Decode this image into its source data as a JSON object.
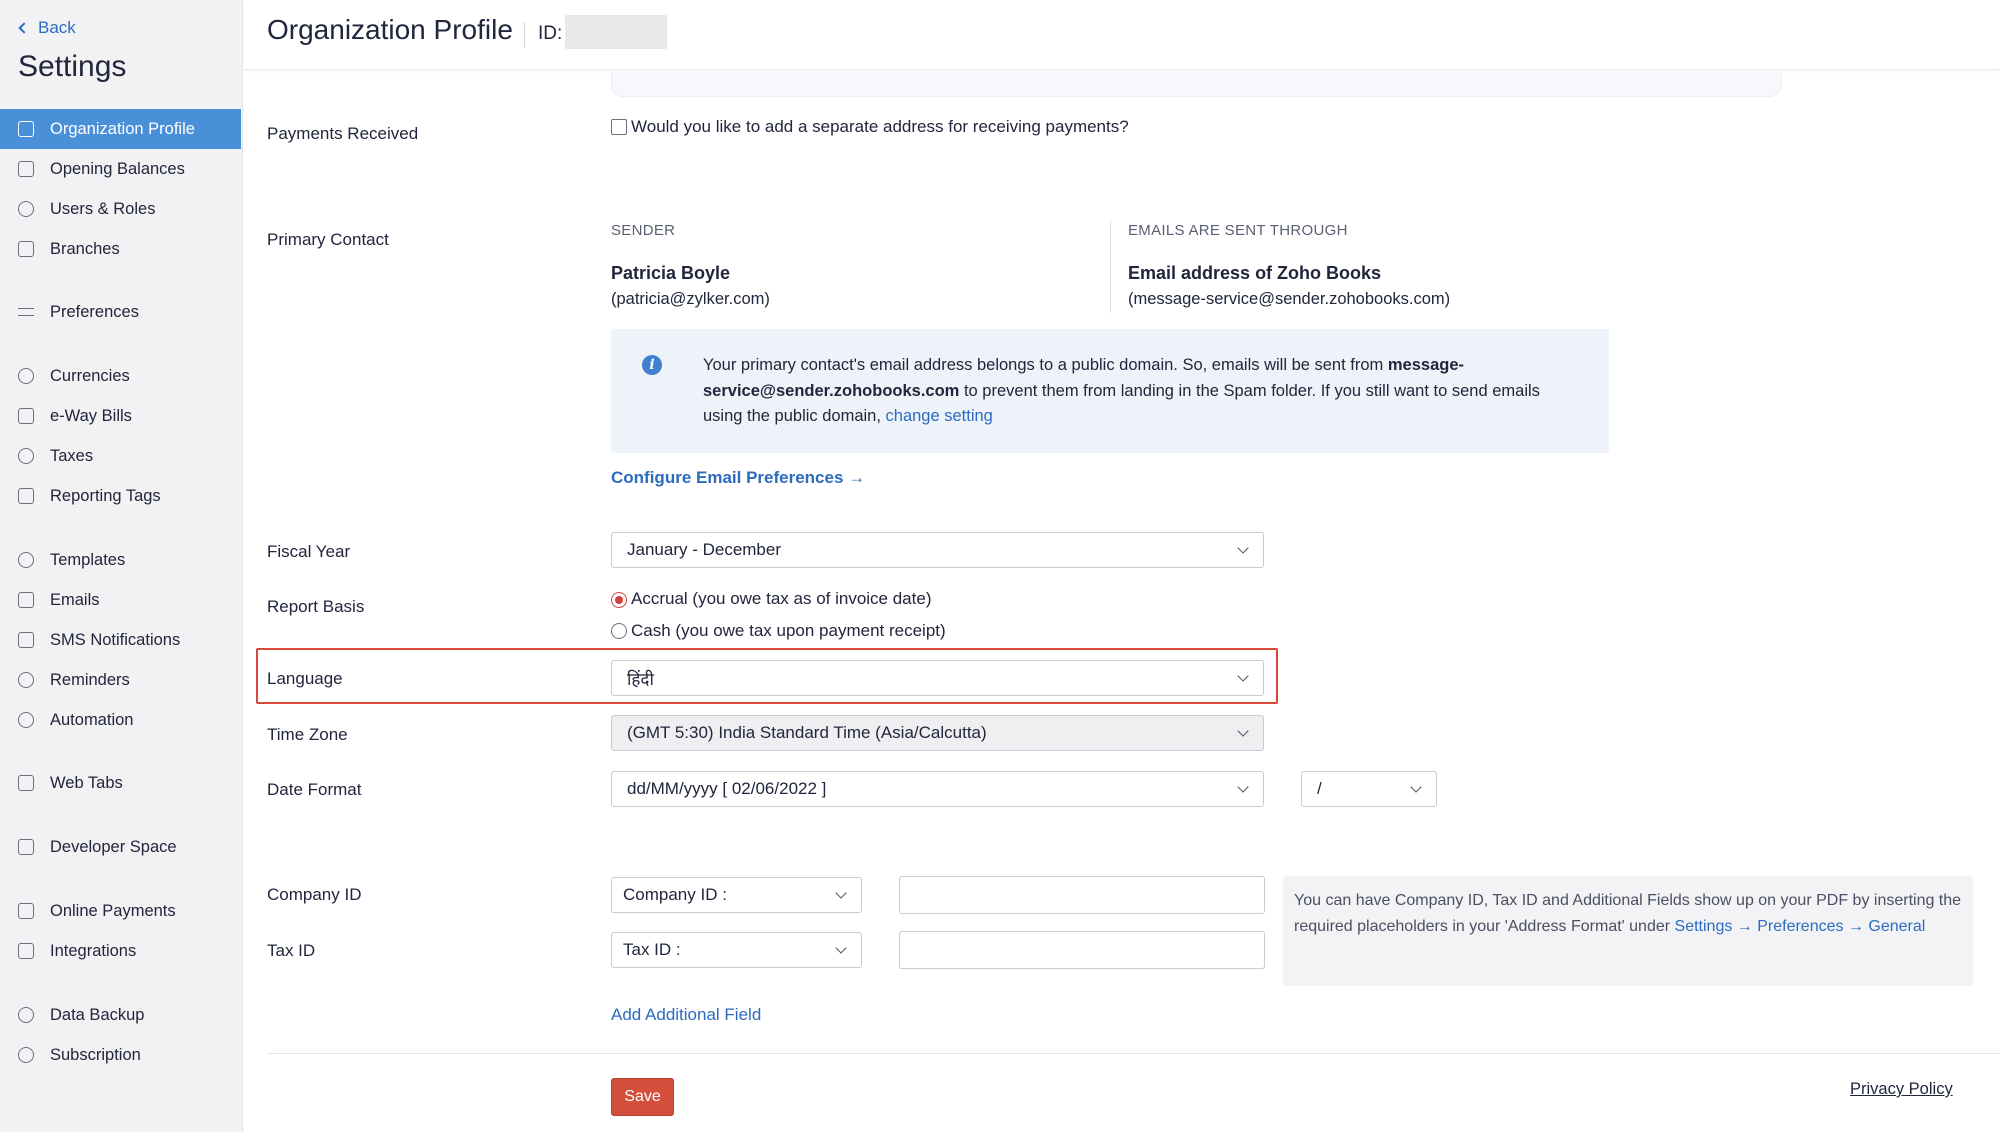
{
  "sidebar": {
    "back_label": "Back",
    "title": "Settings",
    "items": [
      {
        "label": "Organization Profile",
        "icon": "building-icon"
      },
      {
        "label": "Opening Balances",
        "icon": "ledger-icon"
      },
      {
        "label": "Users & Roles",
        "icon": "users-icon"
      },
      {
        "label": "Branches",
        "icon": "branches-icon"
      },
      {
        "label": "Preferences",
        "icon": "sliders-icon"
      },
      {
        "label": "Currencies",
        "icon": "currency-icon"
      },
      {
        "label": "e-Way Bills",
        "icon": "eway-bill-icon"
      },
      {
        "label": "Taxes",
        "icon": "tax-icon"
      },
      {
        "label": "Reporting Tags",
        "icon": "tag-icon"
      },
      {
        "label": "Templates",
        "icon": "palette-icon"
      },
      {
        "label": "Emails",
        "icon": "email-icon"
      },
      {
        "label": "SMS Notifications",
        "icon": "sms-icon"
      },
      {
        "label": "Reminders",
        "icon": "bell-icon"
      },
      {
        "label": "Automation",
        "icon": "automation-icon"
      },
      {
        "label": "Web Tabs",
        "icon": "web-tabs-icon"
      },
      {
        "label": "Developer Space",
        "icon": "code-icon"
      },
      {
        "label": "Online Payments",
        "icon": "payments-icon"
      },
      {
        "label": "Integrations",
        "icon": "integrations-icon"
      },
      {
        "label": "Data Backup",
        "icon": "backup-icon"
      },
      {
        "label": "Subscription",
        "icon": "subscription-icon"
      }
    ]
  },
  "header": {
    "title": "Organization Profile",
    "id_label": "ID:"
  },
  "payments": {
    "label": "Payments Received",
    "checkbox_label": "Would you like to add a separate address for receiving payments?"
  },
  "primary_contact": {
    "label": "Primary Contact",
    "sender_heading": "SENDER",
    "sender_name": "Patricia Boyle",
    "sender_email": "(patricia@zylker.com)",
    "through_heading": "EMAILS ARE SENT THROUGH",
    "through_name": "Email address of Zoho Books",
    "through_email": "(message-service@sender.zohobooks.com)",
    "info_part1": "Your primary contact's email address belongs to a public domain. So, emails will be sent from ",
    "info_bold": "message-service@sender.zohobooks.com",
    "info_part2": " to prevent them from landing in the Spam folder. If you still want to send emails using the public domain, ",
    "info_link": "change setting",
    "configure_link": "Configure Email Preferences"
  },
  "fiscal_year": {
    "label": "Fiscal Year",
    "value": "January - December"
  },
  "report_basis": {
    "label": "Report Basis",
    "options": [
      {
        "label": "Accrual (you owe tax as of invoice date)",
        "selected": true
      },
      {
        "label": "Cash (you owe tax upon payment receipt)",
        "selected": false
      }
    ]
  },
  "language": {
    "label": "Language",
    "value": "हिंदी"
  },
  "time_zone": {
    "label": "Time Zone",
    "value": "(GMT 5:30) India Standard Time (Asia/Calcutta)"
  },
  "date_format": {
    "label": "Date Format",
    "value": "dd/MM/yyyy [ 02/06/2022 ]",
    "separator": "/"
  },
  "company_id": {
    "label": "Company ID",
    "select_value": "Company ID :",
    "input_value": ""
  },
  "tax_id": {
    "label": "Tax ID",
    "select_value": "Tax ID :",
    "input_value": ""
  },
  "note": {
    "text": "You can have Company ID, Tax ID and Additional Fields show up on your PDF by inserting the required placeholders in your 'Address Format' under ",
    "link": "Settings → Preferences → General"
  },
  "add_field_label": "Add Additional Field",
  "save_label": "Save",
  "privacy_label": "Privacy Policy",
  "colors": {
    "accent": "#4a90d9",
    "link": "#2c6bbf",
    "save": "#d34f3c",
    "highlight": "#d9483b"
  }
}
